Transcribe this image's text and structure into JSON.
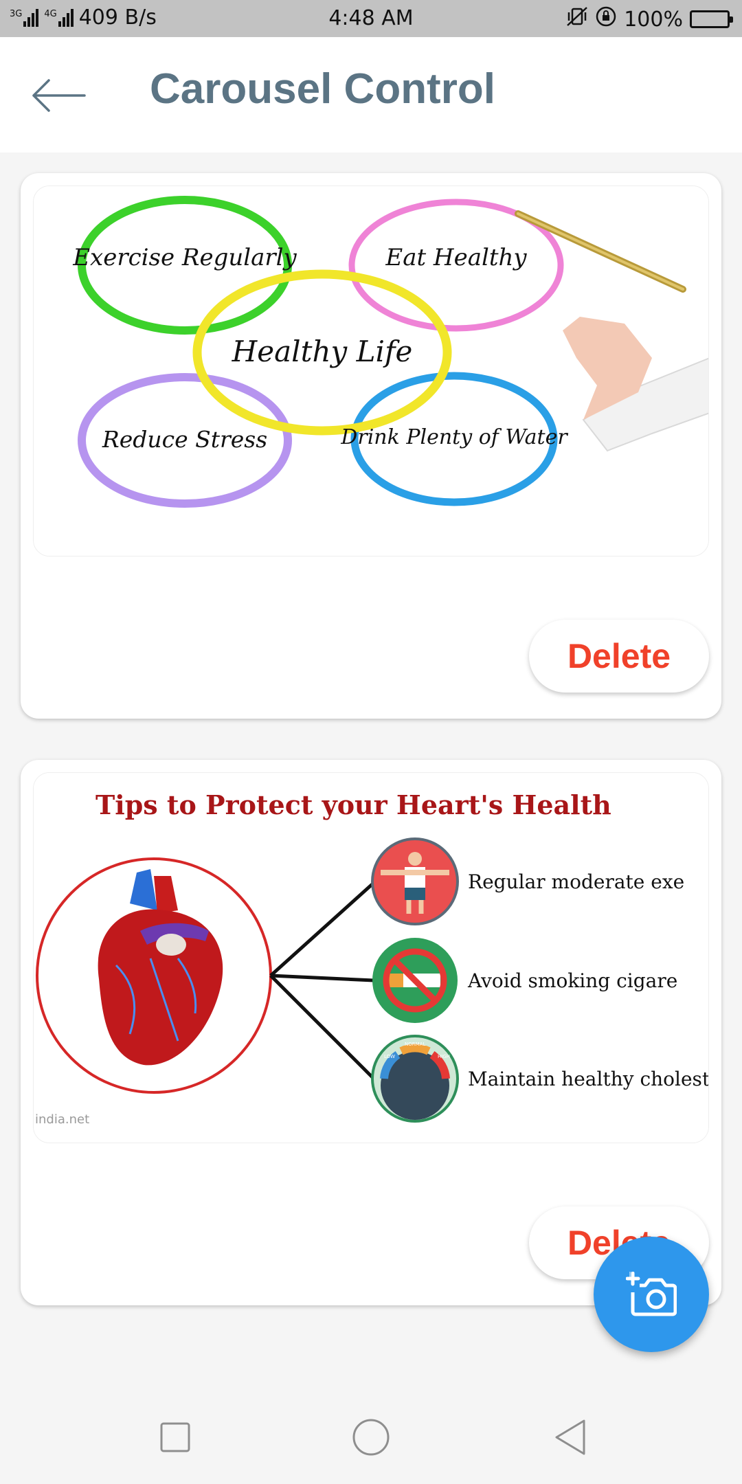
{
  "status_bar": {
    "network_left": "3G",
    "network_right": "4G",
    "speed": "409 B/s",
    "time": "4:48 AM",
    "battery": "100%"
  },
  "app_bar": {
    "back_icon": "arrow-left-icon",
    "title": "Carousel Control"
  },
  "cards": [
    {
      "image": {
        "circles": [
          {
            "text": "Exercise Regularly",
            "color": "#3cd12b"
          },
          {
            "text": "Eat Healthy",
            "color": "#ef83d6"
          },
          {
            "text": "Healthy Life",
            "color": "#f1e62a"
          },
          {
            "text": "Reduce Stress",
            "color": "#b694ef"
          },
          {
            "text": "Drink Plenty of Water",
            "color": "#2a9fe6"
          }
        ]
      },
      "delete_label": "Delete"
    },
    {
      "image": {
        "heading": "Tips to Protect your Heart's Health",
        "tips": [
          "Regular moderate exe",
          "Avoid smoking cigare",
          "Maintain healthy cholesterol levels"
        ],
        "watermark": "india.net",
        "gauge_labels": [
          "LOW",
          "NORMAL",
          "HIGH"
        ]
      },
      "delete_label": "Delete"
    }
  ],
  "fab": {
    "icon": "add-photo-icon"
  },
  "nav_bar": {
    "icons": [
      "recent-apps-icon",
      "home-icon",
      "back-triangle-icon"
    ]
  },
  "colors": {
    "accent": "#2e97ec",
    "delete": "#f0412a",
    "title": "#5b7484",
    "heading_red": "#a81618"
  }
}
